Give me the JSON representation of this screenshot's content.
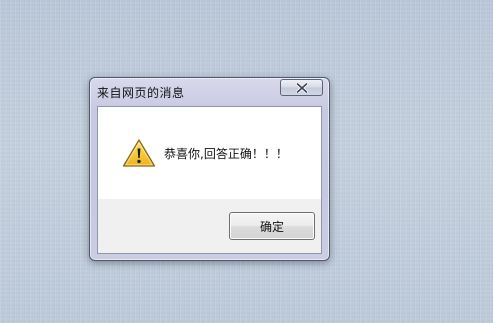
{
  "dialog": {
    "title": "来自网页的消息",
    "message": "恭喜你,回答正确！！！",
    "icon": "warning-icon",
    "ok_label": "确定",
    "close_icon": "close-icon"
  },
  "colors": {
    "desktop": "#c1cddd",
    "frame": "#c8c8e2",
    "content_bg": "#ffffff",
    "button_area": "#f0f0f0",
    "warning_yellow": "#f3c11f"
  }
}
